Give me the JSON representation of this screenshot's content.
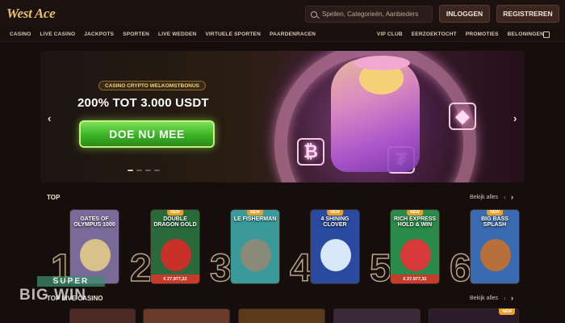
{
  "header": {
    "logo": "West Ace",
    "search_placeholder": "Spellen, Categorieën, Aanbieders",
    "login_label": "INLOGGEN",
    "register_label": "REGISTREREN"
  },
  "nav": {
    "left": [
      "CASINO",
      "LIVE CASINO",
      "JACKPOTS",
      "SPORTEN",
      "LIVE WEDDEN",
      "VIRTUELE SPORTEN",
      "PAARDENRACEN"
    ],
    "right": [
      "VIP CLUB",
      "EERZOEKTOCHT",
      "PROMOTIES",
      "BELONINGEN"
    ]
  },
  "hero": {
    "badge": "CASINO CRYPTO WELKOMSTBONUS",
    "headline": "200% TOT 3.000 USDT",
    "cta_label": "DOE NU MEE",
    "slides_total": 4,
    "slide_active": 1
  },
  "top": {
    "title": "TOP",
    "see_all": "Bekijk alles",
    "games": [
      {
        "rank": "1",
        "title": "GATES OF OLYMPUS 1000",
        "new": "",
        "jackpot": "",
        "bg": "#7a6a9a"
      },
      {
        "rank": "2",
        "title": "DOUBLE DRAGON GOLD",
        "new": "NEW",
        "jackpot": "€ 27.977,32",
        "bg": "#2a6a3a"
      },
      {
        "rank": "3",
        "title": "LE FISHERMAN",
        "new": "NEW",
        "jackpot": "",
        "bg": "#3a9a9a"
      },
      {
        "rank": "4",
        "title": "4 SHINING CLOVER",
        "new": "NEW",
        "jackpot": "",
        "bg": "#2a4aa0"
      },
      {
        "rank": "5",
        "title": "RICH EXPRESS HOLD & WIN",
        "new": "NEW",
        "jackpot": "€ 27.977,32",
        "bg": "#2a8a4a"
      },
      {
        "rank": "6",
        "title": "BIG BASS SPLASH",
        "new": "NEW",
        "jackpot": "",
        "bg": "#3a6ab0"
      }
    ]
  },
  "live": {
    "title": "TOP LIVE CASINO",
    "see_all": "Bekijk alles",
    "new": "NEW"
  },
  "watermark": {
    "top": "SUPER",
    "bottom": "BIG WIN"
  },
  "colors": {
    "background": "#150e0c",
    "cta_green": "#3bb325",
    "accent_gold": "#e9c16b"
  }
}
